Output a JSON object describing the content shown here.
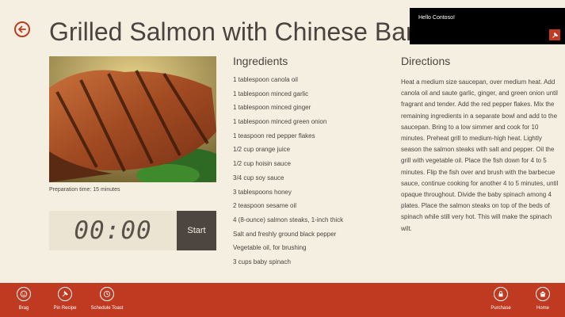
{
  "page": {
    "title": "Grilled Salmon with Chinese Barbecue Sauce"
  },
  "toast": {
    "message": "Hello Contoso!",
    "icon": "pin-icon"
  },
  "recipe": {
    "prep_time": "Preparation time: 15 minutes",
    "timer": {
      "display": "00:00",
      "start_label": "Start"
    }
  },
  "ingredients": {
    "heading": "Ingredients",
    "items": [
      "1 tablespoon canola oil",
      "1 tablespoon minced garlic",
      "1 tablespoon minced ginger",
      "1 tablespoon minced green onion",
      "1 teaspoon red pepper flakes",
      "1/2 cup orange juice",
      "1/2 cup hoisin sauce",
      "3/4 cup soy sauce",
      "3 tablespoons honey",
      "2 teaspoon sesame oil",
      "4 (8-ounce) salmon steaks, 1-inch thick",
      "Salt and freshly ground black pepper",
      "Vegetable oil, for brushing",
      "3 cups baby spinach"
    ]
  },
  "directions": {
    "heading": "Directions",
    "text": "Heat a medium size saucepan, over medium heat. Add canola oil and saute garlic, ginger, and green onion until fragrant and tender. Add the red pepper flakes. Mix the remaining ingredients in a separate bowl and add to the saucepan. Bring to a low simmer and cook for 10 minutes. Preheat grill to medium-high heat. Lightly season the salmon steaks with salt and pepper. Oil the grill with vegetable oil. Place the fish down for 4 to 5 minutes. Flip the fish over and brush with the barbecue sauce, continue cooking for another 4 to 5 minutes, until opaque throughout. Divide the baby spinach among 4 plates. Place the salmon steaks on top of the beds of spinach while still very hot. This will make the spinach wilt."
  },
  "appbar": {
    "brag": "Brag",
    "pin": "Pin Recipe",
    "toast": "Schedule Toast",
    "purchase": "Purchase",
    "home": "Home"
  },
  "colors": {
    "accent": "#c03a22",
    "background": "#f5efe1",
    "timer_button": "#4d4540"
  }
}
